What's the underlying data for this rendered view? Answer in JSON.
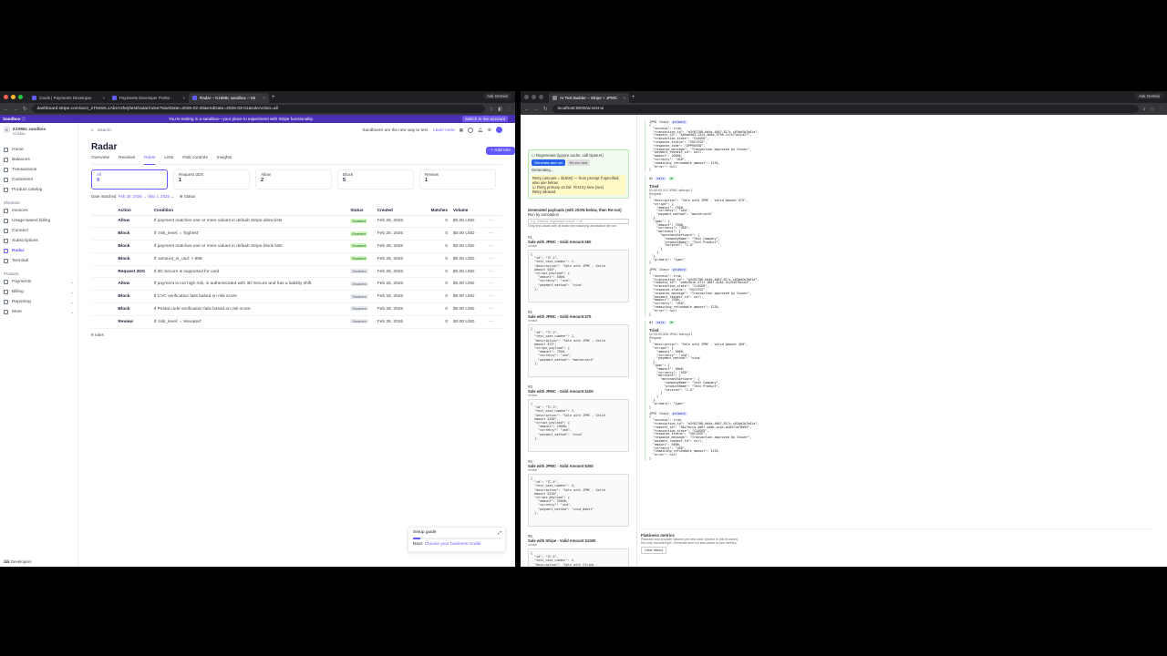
{
  "left_browser": {
    "tabs": [
      {
        "title": "Cards | Payments Developer"
      },
      {
        "title": "Payments Developer Portal -"
      },
      {
        "title": "Radar – K1988c sandbox – Str"
      }
    ],
    "gemini": "Ask Gemini",
    "url": "dashboard.stripe.com/acct_1T5s9zL1AbzA2hej/test/radar/rules?startDate=2026-02-28&endDate=2026-03-01&ruleAction=all"
  },
  "sandbox_bar": {
    "label": "Sandbox",
    "message": "You're testing in a sandbox—your place to experiment with Stripe functionality.",
    "switch": "Switch to live account"
  },
  "account": {
    "name": "K1988c sandbox",
    "sub": "K1988c",
    "initial": "K"
  },
  "sidebar": {
    "main": [
      {
        "label": "Home"
      },
      {
        "label": "Balances"
      },
      {
        "label": "Transactions"
      },
      {
        "label": "Customers"
      },
      {
        "label": "Product catalog"
      }
    ],
    "shortcuts_label": "Shortcuts",
    "shortcuts": [
      {
        "label": "Invoices"
      },
      {
        "label": "Usage-based billing"
      },
      {
        "label": "Connect"
      },
      {
        "label": "Subscriptions"
      },
      {
        "label": "Radar"
      },
      {
        "label": "Terminal"
      }
    ],
    "products_label": "Products",
    "products": [
      {
        "label": "Payments"
      },
      {
        "label": "Billing"
      },
      {
        "label": "Reporting"
      },
      {
        "label": "More"
      }
    ],
    "footer": "Developers"
  },
  "topbar": {
    "search": "Search",
    "notice": "Sandboxes are the new way to test.",
    "learn_more": "Learn more"
  },
  "page": {
    "title": "Radar",
    "add_rule": "+ Add rule",
    "tabs": [
      "Overview",
      "Reviews",
      "Rules",
      "Lists",
      "Risk controls",
      "Insights"
    ],
    "filters": [
      {
        "label": "All",
        "count": "9"
      },
      {
        "label": "Request 3DS",
        "count": "1"
      },
      {
        "label": "Allow",
        "count": "2"
      },
      {
        "label": "Block",
        "count": "5"
      },
      {
        "label": "Review",
        "count": "1"
      }
    ],
    "date_chip": "Date matched",
    "date_value": "Feb 28, 2026 → Mar 1, 2026",
    "status_chip": "Status"
  },
  "table": {
    "headers": [
      "Action",
      "Condition",
      "Status",
      "Created",
      "Matches",
      "Volume"
    ],
    "rows": [
      {
        "action": "Allow",
        "condition": "If payment matches one or more values in default Stripe allow lists",
        "status": "Enabled",
        "created": "Feb 28, 2026",
        "matches": "0",
        "volume": "$0.00 USD"
      },
      {
        "action": "Block",
        "condition": "If :risk_level: = 'highest'",
        "status": "Enabled",
        "created": "Feb 28, 2026",
        "matches": "0",
        "volume": "$0.00 USD"
      },
      {
        "action": "Block",
        "condition": "If payment matches one or more values in default Stripe block lists",
        "status": "Enabled",
        "created": "Feb 28, 2026",
        "matches": "0",
        "volume": "$0.00 USD"
      },
      {
        "action": "Block",
        "condition": "If :amount_in_usd: > 999",
        "status": "Enabled",
        "created": "Feb 28, 2026",
        "matches": "0",
        "volume": "$0.00 USD"
      },
      {
        "action": "Request 3DS",
        "condition": "If 3D Secure is supported for card",
        "status": "Disabled",
        "created": "Feb 28, 2026",
        "matches": "0",
        "volume": "$0.00 USD"
      },
      {
        "action": "Allow",
        "condition": "If payment is not high risk, is authenticated with 3D Secure and has a liability shift",
        "status": "Disabled",
        "created": "Feb 28, 2026",
        "matches": "0",
        "volume": "$0.00 USD"
      },
      {
        "action": "Block",
        "condition": "If CVC verification fails based on risk score",
        "status": "Disabled",
        "created": "Feb 28, 2026",
        "matches": "0",
        "volume": "$0.00 USD"
      },
      {
        "action": "Block",
        "condition": "If Postal code verification fails based on risk score",
        "status": "Disabled",
        "created": "Feb 28, 2026",
        "matches": "0",
        "volume": "$0.00 USD"
      },
      {
        "action": "Review",
        "condition": "If :risk_level: = 'elevated'",
        "status": "Disabled",
        "created": "Feb 28, 2026",
        "matches": "0",
        "volume": "$0.00 USD"
      }
    ],
    "count": "9 rules"
  },
  "setup_guide": {
    "title": "Setup guide",
    "next_label": "Next:",
    "next_link": "Choose your business model",
    "progress": 0.08
  },
  "right_browser": {
    "tab": "AI Test Builder – Stripe + JPMC",
    "gemini": "Ask Gemini",
    "url": "localhost:8000/ai-test-ui"
  },
  "ai_left": {
    "regenerate": "Regenerate (ignore cache, call OpenAI)",
    "btn_generate": "Generate and run",
    "btn_rerun": "Re-run test",
    "generating": "Generating...",
    "retry_note": "Retry (amount = $1500) — from prompt if specified, else use below:",
    "retry_primary": "Retry primary on fail",
    "retry_first": "First try time (sec)",
    "retry_allowed": "Retry allowed",
    "payloads_heading": "Generated payloads (edit JSON below, then Re-run)",
    "run_by": "Run by annotation",
    "filter_placeholder": "e.g. timeout, regression compl. + all",
    "filter_note": "Only test cases with at least one matching annotation are run.",
    "cases": [
      {
        "num": "#1",
        "title": "Sale with JPMC - Valid Amount $50",
        "sub": "similar",
        "json": "{\n  \"id\": \"TC-1\",\n  \"test_case_number\": 1,\n  \"description\": \"Sale with JPMC - Valid\n  Amount $50\",\n  \"stripe_payload\": {\n    \"amount\": 5000,\n    \"currency\": \"usd\",\n    \"payment_method\": \"visa\"\n  },"
      },
      {
        "num": "#2",
        "title": "Sale with JPMC - Valid Amount $75",
        "sub": "similar",
        "json": "{\n  \"id\": \"TC-2\",\n  \"test_case_number\": 2,\n  \"description\": \"Sale with JPMC - Valid\n  Amount $75\",\n  \"stripe_payload\": {\n    \"amount\": 7500,\n    \"currency\": \"usd\",\n    \"payment_method\": \"mastercard\"\n  },"
      },
      {
        "num": "#3",
        "title": "Sale with JPMC - Valid Amount $100",
        "sub": "similar",
        "json": "{\n  \"id\": \"TC-3\",\n  \"test_case_number\": 3,\n  \"description\": \"Sale with JPMC - Valid\n  Amount $100\",\n  \"stripe_payload\": {\n    \"amount\": 10000,\n    \"currency\": \"usd\",\n    \"payment_method\": \"visa\"\n  },"
      },
      {
        "num": "#4",
        "title": "Sale with JPMC - Valid Amount $250",
        "sub": "similar",
        "json": "{\n  \"id\": \"TC-4\",\n  \"test_case_number\": 4,\n  \"description\": \"Sale with JPMC - Valid\n  Amount $250\",\n  \"stripe_payload\": {\n    \"amount\": 25000,\n    \"currency\": \"usd\",\n    \"payment_method\": \"visa_debit\"\n  },"
      },
      {
        "num": "#5",
        "title": "Sale with Stripe - Valid Amount $1000",
        "sub": "similar",
        "json": "{\n  \"id\": \"TC-5\",\n  \"test_case_number\": 5,\n  \"description\": \"Sale with Stripe -\n  Valid Amount $1000\",\n  \"stripe_payload\": {\n    \"amount\": 100000,\n    \"currency\": \"usd\",\n    \"payment_method\": \"visa\""
      }
    ]
  },
  "ai_right": {
    "top_json_label": "JPMC Chase",
    "top_json": "{\n  \"success\": true,\n  \"transaction_id\": \"a3f62708-6d4d-4667-817c-c83dd2b7b01a\",\n  \"request_id\": \"0d5ad403-2315-4b6a-9798-1c7e71e2ca27\",\n  \"transaction_state\": \"CLOSED\",\n  \"response_status\": \"SUCCESS\",\n  \"response_code\": \"APPROVED\",\n  \"response_message\": \"Transaction approved by Issuer\",\n  \"payment_request_id\": null,\n  \"amount\": 10000,\n  \"currency\": \"USD\",\n  \"remaining_refundable_amount\": 1234,\n  \"error\": null\n}",
    "results": [
      {
        "num": "#2",
        "tag1": "sale",
        "tag2": "OK",
        "title": "Tried",
        "meta": "02:05:43.112  JPMC  attempt 1",
        "request_label": "Request",
        "request_json": "{\n  \"description\": \"Sale with JPMC - Valid Amount $75\",\n  \"stripe\": {\n    \"amount\": 7500,\n    \"currency\": \"usd\",\n    \"payment_method\": \"mastercard\"\n  },\n  \"jpmc\": {\n    \"amount\": 7500,\n    \"currency\": \"USD\",\n    \"merchant\": {\n      \"merchantSoftware\": {\n        \"companyName\": \"Test Company\",\n        \"productName\": \"Test Product\",\n        \"version\": \"1.0\"\n      }\n    }\n  },\n  \"primary\": \"jpmc\"\n}",
        "response_label": "JPMC Chase",
        "response_json": "{\n  \"success\": true,\n  \"transaction_id\": \"a3f62708-6d4d-4667-817c-c83dd2b7b01a\",\n  \"request_id\": \"ed0c5b1e-4f1f-4667-8c82-a129457bccd3\",\n  \"transaction_state\": \"CLOSED\",\n  \"response_status\": \"SUCCESS\",\n  \"response_message\": \"Transaction approved by Issuer\",\n  \"payment_request_id\": null,\n  \"amount\": 7500,\n  \"currency\": \"USD\",\n  \"remaining_refundable_amount\": 1234,\n  \"error\": null\n}"
      },
      {
        "num": "#1",
        "tag1": "sale",
        "tag2": "OK",
        "title": "Tried",
        "meta": "02:05:39.508  JPMC  attempt 1",
        "request_label": "Request",
        "request_json": "{\n  \"description\": \"Sale with JPMC - Valid Amount $50\",\n  \"stripe\": {\n    \"amount\": 5000,\n    \"currency\": \"usd\",\n    \"payment_method\": \"visa\"\n  },\n  \"jpmc\": {\n    \"amount\": 5000,\n    \"currency\": \"USD\",\n    \"merchant\": {\n      \"merchantSoftware\": {\n        \"companyName\": \"Test Company\",\n        \"productName\": \"Test Product\",\n        \"version\": \"1.0\"\n      }\n    }\n  },\n  \"primary\": \"jpmc\"\n}",
        "response_label": "JPMC Chase",
        "response_json": "{\n  \"success\": true,\n  \"transaction_id\": \"a3f62708-6d4d-4667-817c-c83dd2b7b01a\",\n  \"request_id\": \"0b27bcca-4d07-4a0b-ac44-b28371d78095\",\n  \"transaction_state\": \"CLOSED\",\n  \"response_status\": \"SUCCESS\",\n  \"response_message\": \"Transaction approved by Issuer\",\n  \"payment_request_id\": null,\n  \"amount\": 5000,\n  \"currency\": \"USD\",\n  \"remaining_refundable_amount\": 1234,\n  \"error\": null\n}"
      }
    ],
    "flaky_title": "Flakiness metrics",
    "flaky_sub": "Pass/fail and provider failures per test case (stored in this browser).",
    "flaky_note": "No runs recorded yet. Generate and run test cases to see metrics.",
    "flaky_btn": "Clear history"
  },
  "colors": {
    "accent": "#635bff",
    "sandbox": "#4b2fb3",
    "enabled_bg": "#d7f7c2",
    "disabled_bg": "#ebeef1"
  }
}
